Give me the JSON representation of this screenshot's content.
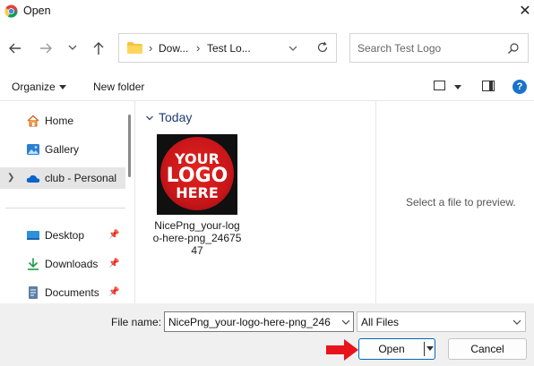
{
  "window": {
    "title": "Open",
    "app_icon": "chrome-icon",
    "close_icon": "close-icon"
  },
  "nav": {
    "back_icon": "arrow-left-icon",
    "forward_icon": "arrow-right-icon",
    "recent_icon": "chevron-down-icon",
    "up_icon": "arrow-up-icon"
  },
  "address": {
    "crumbs": [
      "Dow...",
      "Test Lo..."
    ],
    "separator": "›",
    "folder_icon": "folder-icon",
    "dropdown_icon": "chevron-down-icon",
    "refresh_icon": "refresh-icon"
  },
  "search": {
    "placeholder": "Search Test Logo",
    "icon": "search-icon"
  },
  "toolbar": {
    "organize_label": "Organize",
    "new_folder_label": "New folder",
    "view_icon": "view-icon",
    "pane_icon": "preview-pane-icon",
    "help_icon": "help-icon",
    "help_glyph": "?"
  },
  "sidebar": {
    "items": [
      {
        "label": "Home",
        "icon": "home-icon"
      },
      {
        "label": "Gallery",
        "icon": "gallery-icon"
      },
      {
        "label": "club - Personal",
        "icon": "onedrive-cloud-icon"
      },
      {
        "label": "Desktop",
        "icon": "desktop-icon"
      },
      {
        "label": "Downloads",
        "icon": "download-icon"
      },
      {
        "label": "Documents",
        "icon": "documents-icon"
      }
    ]
  },
  "files": {
    "group_label": "Today",
    "items": [
      {
        "name": "NicePng_your-logo-here-png_2467547",
        "thumbnail_lines": [
          "YOUR",
          "LOGO",
          "HERE"
        ]
      }
    ]
  },
  "preview": {
    "message": "Select a file to preview."
  },
  "footer": {
    "file_name_label": "File name:",
    "file_name_value": "NicePng_your-logo-here-png_246",
    "filter_value": "All Files",
    "open_label": "Open",
    "cancel_label": "Cancel"
  },
  "colors": {
    "accent": "#0067c0",
    "arrow": "#e8141b",
    "group_heading": "#1f3b6f"
  }
}
